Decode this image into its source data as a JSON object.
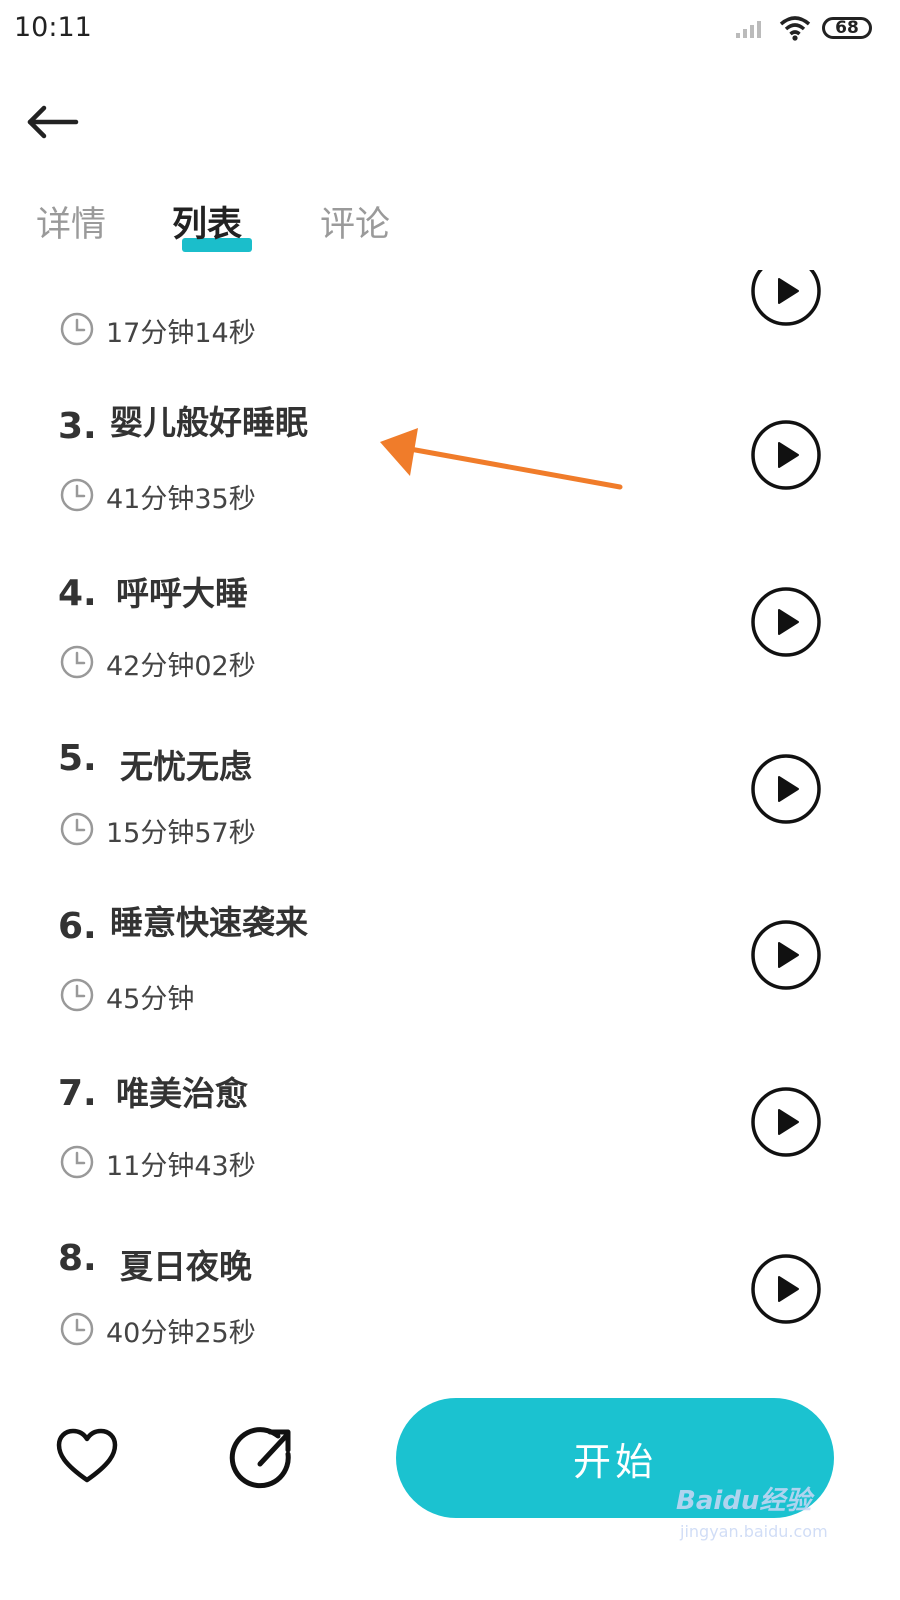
{
  "status_bar": {
    "time": "10:11",
    "battery": "68"
  },
  "tabs": [
    {
      "label": "详情",
      "active": false
    },
    {
      "label": "列表",
      "active": true
    },
    {
      "label": "评论",
      "active": false
    }
  ],
  "tracks": [
    {
      "number": "",
      "title": "",
      "duration": "17分钟14秒"
    },
    {
      "number": "3.",
      "title": "婴儿般好睡眠",
      "duration": "41分钟35秒"
    },
    {
      "number": "4.",
      "title": "呼呼大睡",
      "duration": "42分钟02秒"
    },
    {
      "number": "5.",
      "title": "无忧无虑",
      "duration": "15分钟57秒"
    },
    {
      "number": "6.",
      "title": "睡意快速袭来",
      "duration": "45分钟"
    },
    {
      "number": "7.",
      "title": "唯美治愈",
      "duration": "11分钟43秒"
    },
    {
      "number": "8.",
      "title": "夏日夜晚",
      "duration": "40分钟25秒"
    }
  ],
  "bottom_bar": {
    "start_label": "开始"
  },
  "watermark": {
    "brand": "Baidu经验",
    "url": "jingyan.baidu.com"
  },
  "colors": {
    "accent": "#1bc2d0",
    "arrow": "#f07c2a",
    "text": "#333333",
    "muted": "#9a9a9a"
  },
  "icons": [
    "back-arrow-icon",
    "clock-icon",
    "play-icon",
    "heart-icon",
    "share-icon",
    "wifi-icon",
    "signal-icon",
    "battery-icon"
  ]
}
